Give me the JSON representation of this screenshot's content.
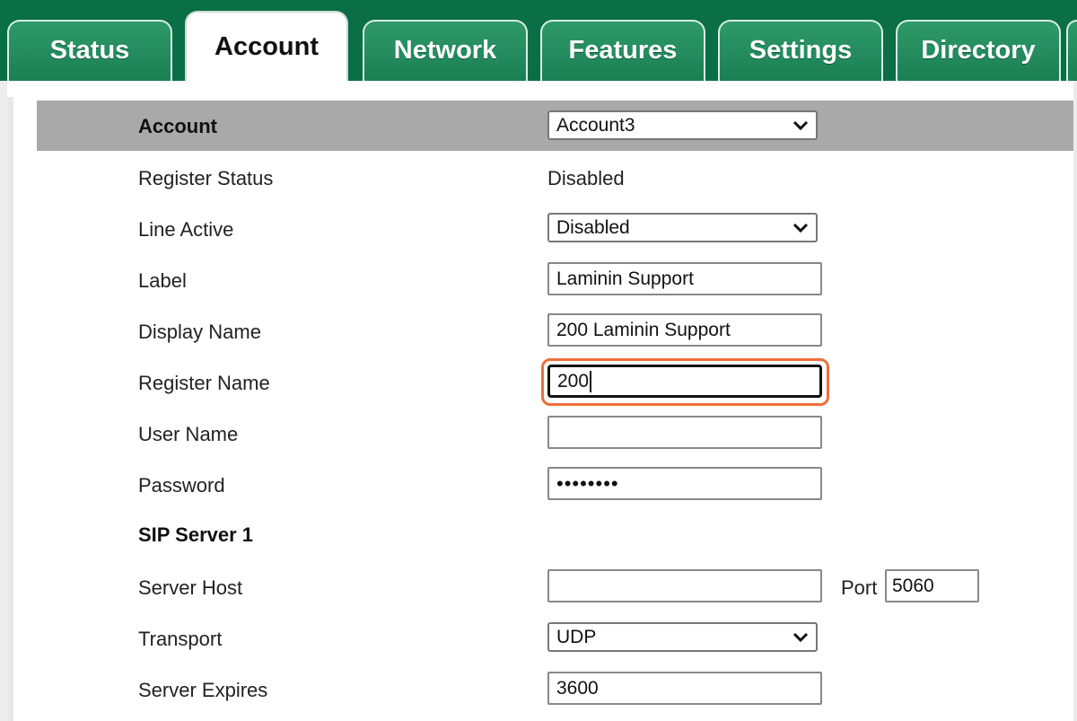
{
  "tabs": [
    {
      "label": "Status",
      "active": false
    },
    {
      "label": "Account",
      "active": true
    },
    {
      "label": "Network",
      "active": false
    },
    {
      "label": "Features",
      "active": false
    },
    {
      "label": "Settings",
      "active": false
    },
    {
      "label": "Directory",
      "active": false
    }
  ],
  "header": {
    "label": "Account",
    "selected": "Account3"
  },
  "fields": {
    "register_status": {
      "label": "Register Status",
      "value": "Disabled"
    },
    "line_active": {
      "label": "Line Active",
      "value": "Disabled"
    },
    "label": {
      "label": "Label",
      "value": "Laminin Support"
    },
    "display_name": {
      "label": "Display Name",
      "value": "200 Laminin Support"
    },
    "register_name": {
      "label": "Register Name",
      "value": "200"
    },
    "user_name": {
      "label": "User Name",
      "value": ""
    },
    "password": {
      "label": "Password",
      "value": "••••••••"
    },
    "sip_server_1": {
      "label": "SIP Server 1"
    },
    "server_host": {
      "label": "Server Host",
      "value": "",
      "port_label": "Port",
      "port_value": "5060"
    },
    "transport": {
      "label": "Transport",
      "value": "UDP"
    },
    "server_expires": {
      "label": "Server Expires",
      "value": "3600"
    }
  },
  "colors": {
    "brand_green": "#0a6e46",
    "focus_ring": "#ee6e3a",
    "header_gray": "#a9a9a9"
  }
}
